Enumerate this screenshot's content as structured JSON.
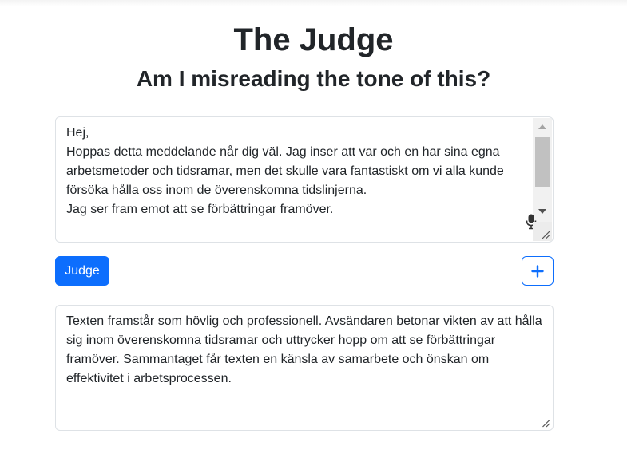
{
  "header": {
    "title": "The Judge",
    "subtitle": "Am I misreading the tone of this?"
  },
  "input": {
    "value": "Hej,\nHoppas detta meddelande når dig väl. Jag inser att var och en har sina egna arbetsmetoder och tidsramar, men det skulle vara fantastiskt om vi alla kunde försöka hålla oss inom de överenskomna tidslinjerna.\nJag ser fram emot att se förbättringar framöver.",
    "icons": [
      "microphone-icon",
      "resize-handle-icon"
    ]
  },
  "actions": {
    "judge_label": "Judge",
    "add_icon": "plus-icon"
  },
  "output": {
    "value": "Texten framstår som hövlig och professionell. Avsändaren betonar vikten av att hålla sig inom överenskomna tidsramar och uttrycker hopp om att se förbättringar framöver. Sammantaget får texten en känsla av samarbete och önskan om effektivitet i arbetsprocessen."
  },
  "colors": {
    "primary": "#0d6efd",
    "text": "#212529",
    "border": "#dee2e6"
  }
}
